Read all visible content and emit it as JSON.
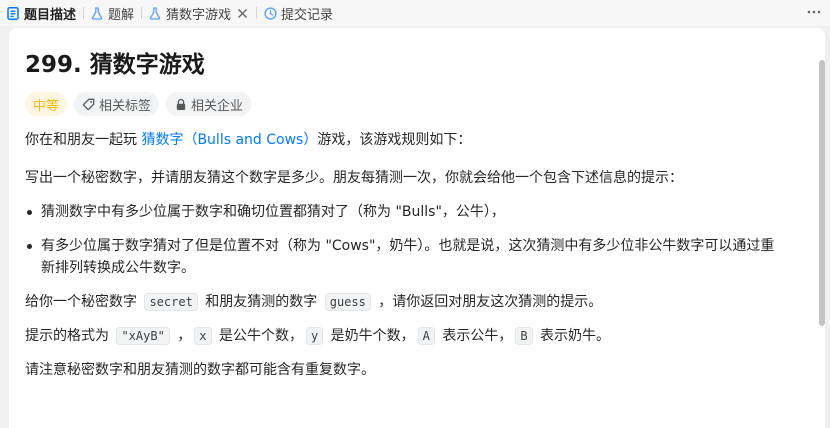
{
  "tabs": [
    {
      "label": "题目描述",
      "icon": "description-icon",
      "active": true
    },
    {
      "label": "题解",
      "icon": "flask-icon",
      "active": false
    },
    {
      "label": "猜数字游戏",
      "icon": "flask-icon",
      "active": false,
      "closable": true
    },
    {
      "label": "提交记录",
      "icon": "history-icon",
      "active": false
    }
  ],
  "problem": {
    "title": "299. 猜数字游戏",
    "difficulty": "中等",
    "tag_related": "相关标签",
    "tag_company": "相关企业"
  },
  "desc": {
    "p1_pre": "你在和朋友一起玩 ",
    "p1_link": "猜数字（Bulls and Cows）",
    "p1_post": "游戏，该游戏规则如下：",
    "p2": "写出一个秘密数字，并请朋友猜这个数字是多少。朋友每猜测一次，你就会给他一个包含下述信息的提示：",
    "bullet1": "猜测数字中有多少位属于数字和确切位置都猜对了（称为 \"Bulls\"，公牛），",
    "bullet2_line1": "有多少位属于数字猜对了但是位置不对（称为 \"Cows\"，奶牛）。也就是说，这次猜测中有多少位非公牛数字可以通过重",
    "bullet2_line2": "新排列转换成公牛数字。",
    "p3_pre": "给你一个秘密数字 ",
    "p3_code1": "secret",
    "p3_mid": " 和朋友猜测的数字 ",
    "p3_code2": "guess",
    "p3_post": " ，请你返回对朋友这次猜测的提示。",
    "p4_pre": "提示的格式为 ",
    "p4_code1": "\"xAyB\"",
    "p4_s1": " ，",
    "p4_code2": "x",
    "p4_s2": " 是公牛个数，",
    "p4_code3": "y",
    "p4_s3": " 是奶牛个数，",
    "p4_code4": "A",
    "p4_s4": " 表示公牛，",
    "p4_code5": "B",
    "p4_s5": " 表示奶牛。",
    "p5": "请注意秘密数字和朋友猜测的数字都可能含有重复数字。"
  },
  "colors": {
    "accent": "#007aff",
    "difficulty": "#ffb800",
    "history_icon": "#5ea0ff"
  }
}
